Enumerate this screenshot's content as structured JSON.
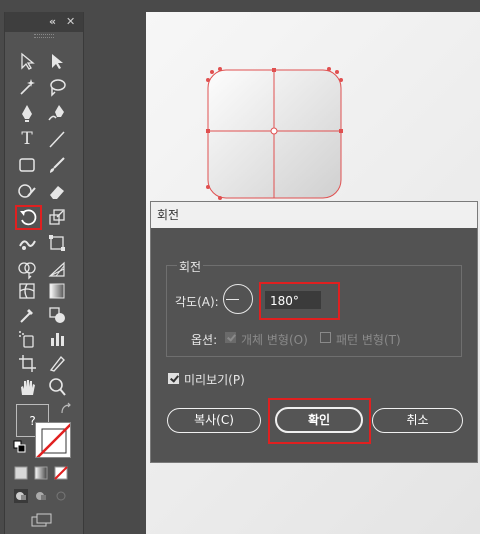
{
  "toolbar": {
    "collapse_glyph": "«",
    "close_glyph": "✕",
    "tools": [
      "selection-icon",
      "direct-selection-icon",
      "magic-wand-icon",
      "lasso-icon",
      "pen-icon",
      "curvature-icon",
      "type-icon",
      "line-segment-icon",
      "rectangle-icon",
      "paintbrush-icon",
      "shaper-icon",
      "eraser-icon",
      "rotate-icon",
      "scale-icon",
      "warp-icon",
      "free-transform-icon",
      "shape-builder-icon",
      "perspective-grid-icon",
      "mesh-icon",
      "gradient-icon",
      "eyedropper-icon",
      "blend-icon",
      "symbol-sprayer-icon",
      "column-graph-icon",
      "artboard-icon",
      "slice-icon",
      "hand-icon",
      "zoom-icon"
    ],
    "fill_label": "?",
    "colors": {
      "accent": "#e02020",
      "panel": "#535353"
    }
  },
  "dialog": {
    "title": "회전",
    "group_label": "회전",
    "angle_label": "각도(A):",
    "angle_value": "180°",
    "options_label": "옵션:",
    "transform_objects_label": "개체 변형(O)",
    "transform_patterns_label": "패턴 변형(T)",
    "preview_label": "미리보기(P)",
    "copy_button": "복사(C)",
    "ok_button": "확인",
    "cancel_button": "취소"
  }
}
